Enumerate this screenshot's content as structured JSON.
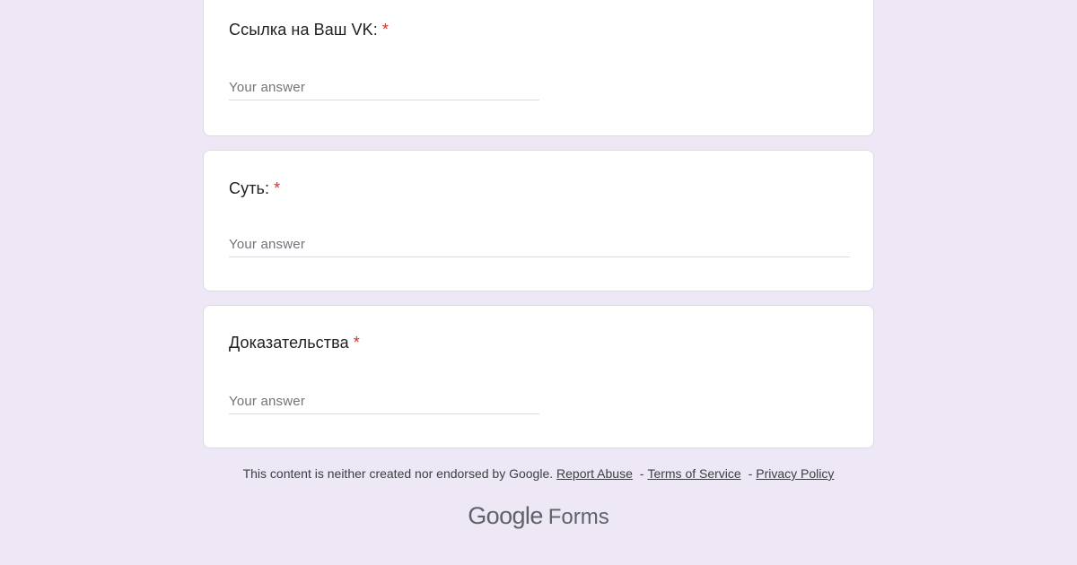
{
  "questions": [
    {
      "label": "Ссылка на Ваш VK:",
      "required_mark": "*",
      "placeholder": "Your answer"
    },
    {
      "label": "Суть:",
      "required_mark": "*",
      "placeholder": "Your answer"
    },
    {
      "label": "Доказательства",
      "required_mark": "*",
      "placeholder": "Your answer"
    }
  ],
  "footer": {
    "disclaimer": "This content is neither created nor endorsed by Google.",
    "report_abuse": "Report Abuse",
    "terms": "Terms of Service",
    "privacy": "Privacy Policy",
    "separator": "-"
  },
  "brand": {
    "google": "Google",
    "forms": "Forms"
  },
  "colors": {
    "background": "#ede7f6",
    "required": "#d93025"
  }
}
